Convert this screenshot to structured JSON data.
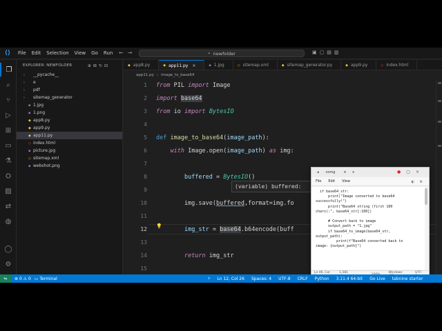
{
  "titlebar": {
    "menu": [
      "File",
      "Edit",
      "Selection",
      "View",
      "Go",
      "Run"
    ],
    "search": "newfolder"
  },
  "sidebar": {
    "header": "EXPLORER: NEWFOLDER",
    "items": [
      {
        "label": "__pycache__",
        "type": "folder"
      },
      {
        "label": "e",
        "type": "folder"
      },
      {
        "label": "pdf",
        "type": "folder"
      },
      {
        "label": "sitemap_generator",
        "type": "folder"
      },
      {
        "label": "1.jpg",
        "type": "file"
      },
      {
        "label": "1.png",
        "type": "file"
      },
      {
        "label": "app8.py",
        "type": "file"
      },
      {
        "label": "app9.py",
        "type": "file"
      },
      {
        "label": "app11.py",
        "type": "file",
        "selected": true
      },
      {
        "label": "index.html",
        "type": "file"
      },
      {
        "label": "picture.jpg",
        "type": "file"
      },
      {
        "label": "sitemap.xml",
        "type": "file"
      },
      {
        "label": "webshot.png",
        "type": "file"
      }
    ]
  },
  "tabs": [
    "app8.py",
    "app11.py",
    "1.jpg",
    "sitemap.xml",
    "sitemap_generator.py",
    "app9.py",
    "index.html"
  ],
  "active_tab": "app11.py",
  "breadcrumb": [
    "app11.py",
    "image_to_base64"
  ],
  "editor": {
    "lines": [
      {
        "n": "1",
        "tokens": [
          [
            "kw",
            "from"
          ],
          [
            "t",
            " PIL "
          ],
          [
            "kw",
            "import"
          ],
          [
            "t",
            " Image"
          ]
        ]
      },
      {
        "n": "2",
        "tokens": [
          [
            "kw",
            "import"
          ],
          [
            "t",
            " "
          ],
          [
            "hl",
            "base64"
          ]
        ]
      },
      {
        "n": "3",
        "tokens": [
          [
            "kw",
            "from"
          ],
          [
            "t",
            " io "
          ],
          [
            "kw",
            "import"
          ],
          [
            "t",
            " "
          ],
          [
            "cls",
            "BytesIO"
          ]
        ]
      },
      {
        "n": "4",
        "tokens": []
      },
      {
        "n": "5",
        "tokens": [
          [
            "kw2",
            "def"
          ],
          [
            "t",
            " "
          ],
          [
            "fn",
            "image_to_base64"
          ],
          [
            "t",
            "("
          ],
          [
            "var",
            "image_path"
          ],
          [
            "t",
            "):"
          ]
        ]
      },
      {
        "n": "6",
        "tokens": [
          [
            "t",
            "    "
          ],
          [
            "kw",
            "with"
          ],
          [
            "t",
            " Image.open("
          ],
          [
            "var",
            "image_path"
          ],
          [
            "t",
            ") "
          ],
          [
            "kw",
            "as"
          ],
          [
            "t",
            " img:"
          ]
        ]
      },
      {
        "n": "7",
        "tokens": []
      },
      {
        "n": "8",
        "tokens": [
          [
            "t",
            "        "
          ],
          [
            "var",
            "buffered"
          ],
          [
            "t",
            " = "
          ],
          [
            "cls",
            "BytesIO"
          ],
          [
            "t",
            "()"
          ]
        ]
      },
      {
        "n": "9",
        "tokens": []
      },
      {
        "n": "10",
        "tokens": [
          [
            "t",
            "        img.save("
          ],
          [
            "ul",
            "buffered"
          ],
          [
            "t",
            ",format=img.fo"
          ]
        ]
      },
      {
        "n": "11",
        "tokens": []
      },
      {
        "n": "12",
        "tokens": [
          [
            "t",
            "        "
          ],
          [
            "var",
            "img_str"
          ],
          [
            "t",
            " = "
          ],
          [
            "hl",
            "base64"
          ],
          [
            "t",
            ".b64encode(buff"
          ]
        ]
      },
      {
        "n": "13",
        "tokens": []
      },
      {
        "n": "14",
        "tokens": [
          [
            "t",
            "        "
          ],
          [
            "kw",
            "return"
          ],
          [
            "t",
            " img_str"
          ]
        ]
      },
      {
        "n": "15",
        "tokens": []
      }
    ],
    "current_line": "12",
    "hover": "(variable) buffered: "
  },
  "notepad": {
    "tab_title": "comg",
    "menu": [
      "File",
      "Edit",
      "View"
    ],
    "content": "  if base64_str:\n      print(\"Image converted to base64\nsuccessfully!\")\n      print(\"Base64 string (first 100\nchars):\", base64_str[:100])\n\n      # Convert back to image\n      output_path = \"1.jpg\"\n      if base64_to_image(base64_str,\noutput_path):\n          print(f\"Base64 converted back to\nimage: {output_path}\")",
    "status": [
      "Ln 46, Col 1",
      "1,581 characters",
      "100%",
      "Windows (CR",
      "UTF-8"
    ]
  },
  "statusbar": {
    "problems_errors": "0",
    "problems_warnings": "0",
    "terminal": "Terminal",
    "position": "Ln 12, Col 26",
    "spaces": "Spaces: 4",
    "encoding": "UTF-8",
    "eol": "CRLF",
    "language": "Python",
    "interpreter": "3.11.4 64-bit",
    "golive": "Go Live",
    "tabnine": "tabnine starter"
  },
  "colors": {
    "accent": "#0078d4",
    "keyword": "#c586c0",
    "function": "#dcdcaa",
    "class": "#4ec9b0",
    "variable": "#9cdcfe"
  }
}
